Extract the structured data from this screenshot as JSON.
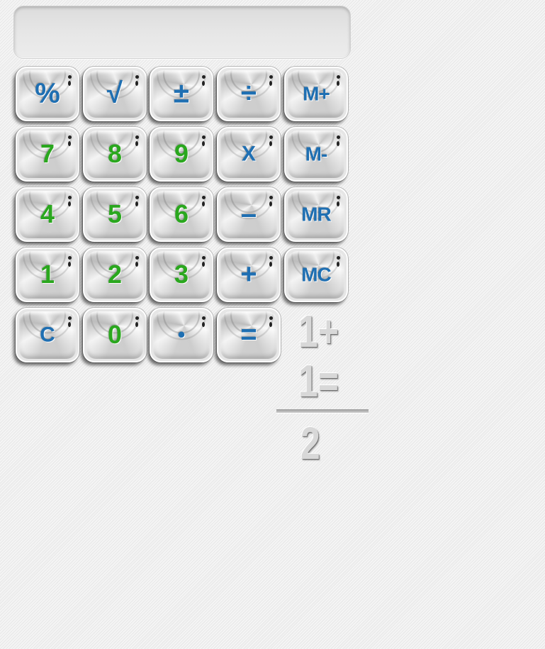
{
  "display": {
    "value": ""
  },
  "keys": [
    {
      "label": "%",
      "color": "blue"
    },
    {
      "label": "√",
      "color": "blue"
    },
    {
      "label": "±",
      "color": "blue"
    },
    {
      "label": "÷",
      "color": "blue"
    },
    {
      "label": "M+",
      "color": "blue"
    },
    {
      "label": "7",
      "color": "green"
    },
    {
      "label": "8",
      "color": "green"
    },
    {
      "label": "9",
      "color": "green"
    },
    {
      "label": "X",
      "color": "blue"
    },
    {
      "label": "M-",
      "color": "blue"
    },
    {
      "label": "4",
      "color": "green"
    },
    {
      "label": "5",
      "color": "green"
    },
    {
      "label": "6",
      "color": "green"
    },
    {
      "label": "–",
      "color": "blue"
    },
    {
      "label": "MR",
      "color": "blue"
    },
    {
      "label": "1",
      "color": "green"
    },
    {
      "label": "2",
      "color": "green"
    },
    {
      "label": "3",
      "color": "green"
    },
    {
      "label": "+",
      "color": "blue"
    },
    {
      "label": "MC",
      "color": "blue"
    },
    {
      "label": "C",
      "color": "blue"
    },
    {
      "label": "0",
      "color": "green"
    },
    {
      "label": "•",
      "color": "blue"
    },
    {
      "label": "=",
      "color": "blue"
    }
  ],
  "decoration": {
    "line1": "1+",
    "line2": "1=",
    "result": "2"
  },
  "colors": {
    "blue": "#1f6fb2",
    "green": "#2aa71e"
  }
}
